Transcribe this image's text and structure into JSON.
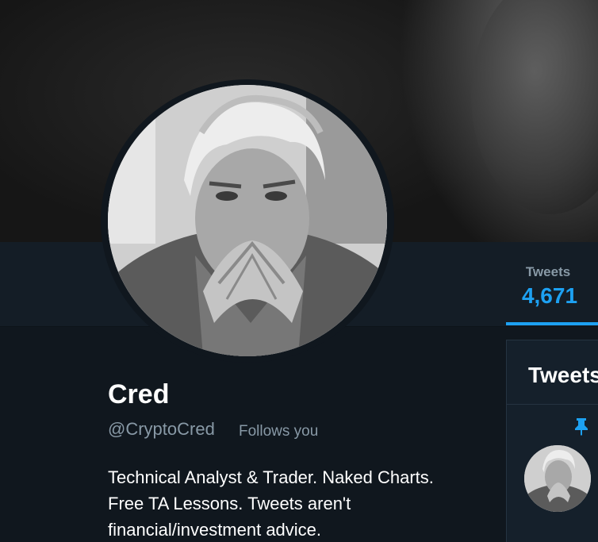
{
  "stats": {
    "tweets_label": "Tweets",
    "tweets_value": "4,671"
  },
  "profile": {
    "name": "Cred",
    "handle": "@CryptoCred",
    "follows_badge": "Follows you",
    "bio_lines": [
      "Technical Analyst & Trader. Naked Charts.",
      "Free TA Lessons. Tweets aren't",
      "financial/investment advice."
    ]
  },
  "timeline": {
    "heading": "Tweets",
    "pin_icon": "pin-icon"
  },
  "colors": {
    "accent": "#1da1f2",
    "background": "#10171e",
    "navbar": "#141d26",
    "muted_text": "#8899a6"
  }
}
